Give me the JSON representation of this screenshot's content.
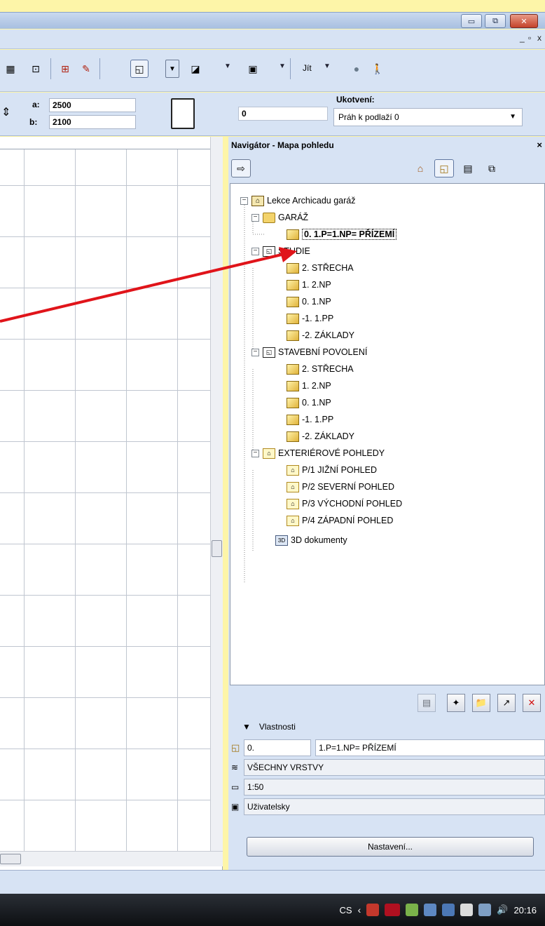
{
  "window": {
    "buttons": {
      "minimize": "▭",
      "restore": "⧉",
      "close": "✕"
    },
    "mdi_controls": {
      "minimize": "_",
      "restore": "▫",
      "close": "x"
    }
  },
  "toolbar": {
    "go_label": "Jít"
  },
  "infobox": {
    "a_label": "a:",
    "a_value": "2500",
    "b_label": "b:",
    "b_value": "2100",
    "offset_value": "0",
    "anchor_label": "Ukotvení:",
    "anchor_value": "Práh k podlaží 0"
  },
  "navigator": {
    "title": "Navigátor - Mapa pohledu",
    "close": "×",
    "tree": {
      "project": "Lekce Archicadu garáž",
      "folder_garaz": "GARÁŽ",
      "garaz_view": "0. 1.P=1.NP= PŘÍZEMÍ",
      "set_studie": "STUDIE",
      "studie_items": [
        "2. STŘECHA",
        "1. 2.NP",
        "0. 1.NP",
        "-1. 1.PP",
        "-2. ZÁKLADY"
      ],
      "set_povoleni": "STAVEBNÍ POVOLENÍ",
      "povoleni_items": [
        "2. STŘECHA",
        "1. 2.NP",
        "0. 1.NP",
        "-1. 1.PP",
        "-2. ZÁKLADY"
      ],
      "set_exterior": "EXTERIÉROVÉ POHLEDY",
      "exterior_items": [
        "P/1 JIŽNÍ POHLED",
        "P/2 SEVERNÍ POHLED",
        "P/3 VÝCHODNÍ POHLED",
        "P/4 ZÁPADNÍ POHLED"
      ],
      "docs3d": "3D dokumenty"
    },
    "properties": {
      "header": "Vlastnosti",
      "id_value": "0.",
      "name_value": "1.P=1.NP= PŘÍZEMÍ",
      "layers": "VŠECHNY VRSTVY",
      "scale": "1:50",
      "zoom": "Uživatelsky",
      "settings_button": "Nastavení..."
    }
  },
  "taskbar": {
    "language": "CS",
    "clock": "20:16"
  },
  "colors": {
    "background": "#fdf5a8",
    "chrome": "#d7e3f4",
    "arrow": "#e0141a"
  }
}
